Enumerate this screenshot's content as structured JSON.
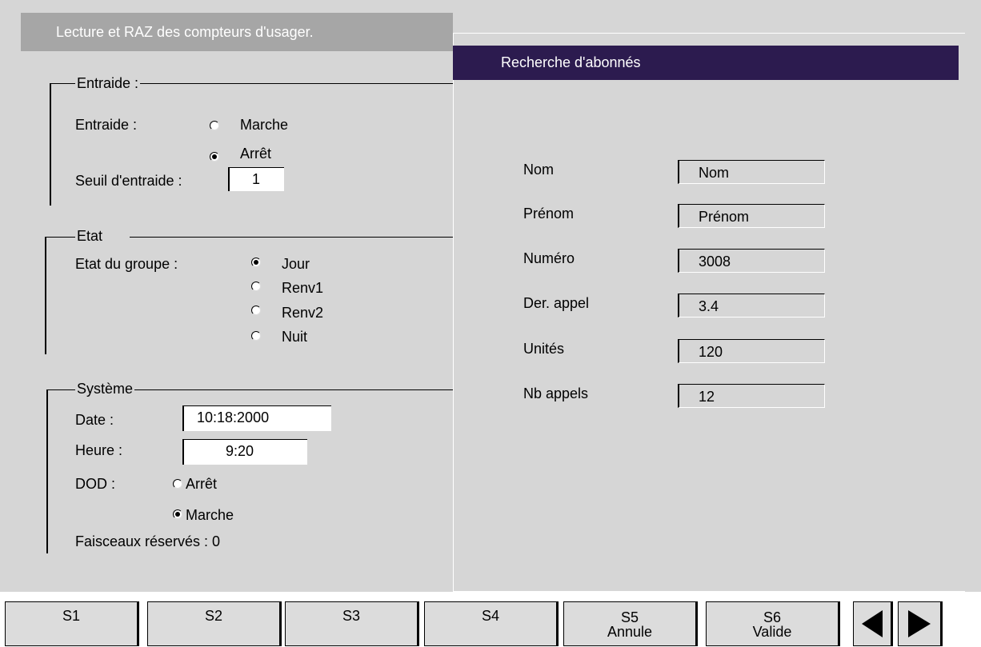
{
  "main": {
    "title": "Lecture et RAZ des compteurs d'usager.",
    "entraide": {
      "legend": "Entraide :",
      "label": "Entraide :",
      "options": [
        "Marche",
        "Arrêt"
      ],
      "selected": "Arrêt",
      "seuil_label": "Seuil d'entraide :",
      "seuil_value": "1"
    },
    "etat": {
      "legend": "Etat",
      "label": "Etat du groupe :",
      "options": [
        "Jour",
        "Renv1",
        "Renv2",
        "Nuit"
      ],
      "selected": "Jour"
    },
    "systeme": {
      "legend": "Système",
      "date_label": "Date :",
      "date_value": "10:18:2000",
      "heure_label": "Heure :",
      "heure_value": "9:20",
      "dod_label": "DOD :",
      "dod_options": [
        "Arrêt",
        "Marche"
      ],
      "dod_selected": "Marche",
      "faisceaux": "Faisceaux réservés : 0"
    }
  },
  "search": {
    "title": "Recherche d'abonnés",
    "fields": [
      {
        "label": "Nom",
        "value": "Nom"
      },
      {
        "label": "Prénom",
        "value": "Prénom"
      },
      {
        "label": "Numéro",
        "value": "3008"
      },
      {
        "label": "Der. appel",
        "value": "3.4"
      },
      {
        "label": "Unités",
        "value": "120"
      },
      {
        "label": "Nb appels",
        "value": "12"
      }
    ]
  },
  "softkeys": [
    {
      "line1": "S1",
      "line2": ""
    },
    {
      "line1": "S2",
      "line2": ""
    },
    {
      "line1": "S3",
      "line2": ""
    },
    {
      "line1": "S4",
      "line2": ""
    },
    {
      "line1": "S5",
      "line2": "Annule"
    },
    {
      "line1": "S6",
      "line2": "Valide"
    }
  ],
  "icons": {
    "prev": "left-arrow-icon",
    "next": "right-arrow-icon"
  },
  "colors": {
    "background": "#d6d6d6",
    "title_bar": "#a6a6a6",
    "overlay_title": "#2c1b4f"
  }
}
